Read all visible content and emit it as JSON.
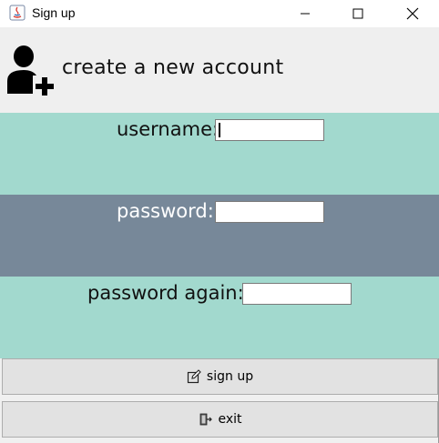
{
  "window": {
    "title": "Sign up"
  },
  "header": {
    "title": "create a new account"
  },
  "form": {
    "username_label": "username:",
    "username_value": "",
    "password_label": "password:",
    "password_value": "",
    "password_again_label": "password again:",
    "password_again_value": ""
  },
  "buttons": {
    "signup_label": "sign up",
    "exit_label": "exit"
  },
  "colors": {
    "band_teal": "#a2d9ce",
    "band_slate": "#778899",
    "header_bg": "#efefef",
    "button_bg": "#e2e2e2"
  },
  "icons": {
    "app": "java-app-icon",
    "header": "add-user-icon",
    "signup": "edit-icon",
    "exit": "exit-door-icon"
  }
}
